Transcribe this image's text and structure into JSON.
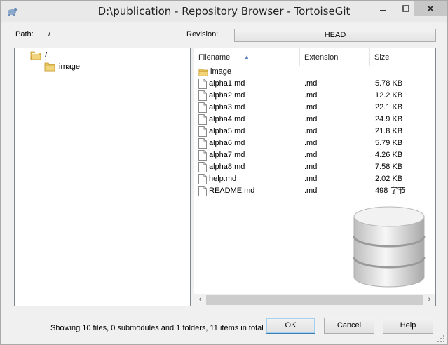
{
  "window": {
    "title": "D:\\publication - Repository Browser - TortoiseGit",
    "icon": "tortoise-icon",
    "controls": [
      "minimize",
      "maximize",
      "close"
    ]
  },
  "path": {
    "label": "Path:",
    "value": "/"
  },
  "revision": {
    "label": "Revision:",
    "button_label": "HEAD"
  },
  "tree": {
    "root": {
      "label": "/",
      "icon": "folder-open-icon"
    },
    "children": [
      {
        "label": "image",
        "icon": "folder-icon"
      }
    ]
  },
  "list": {
    "headers": {
      "filename": "Filename",
      "extension": "Extension",
      "size": "Size"
    },
    "sort": {
      "column": "filename",
      "direction": "ascending"
    },
    "rows": [
      {
        "name": "image",
        "extension": "",
        "size": "",
        "type": "folder"
      },
      {
        "name": "alpha1.md",
        "extension": ".md",
        "size": "5.78 KB",
        "type": "file"
      },
      {
        "name": "alpha2.md",
        "extension": ".md",
        "size": "12.2 KB",
        "type": "file"
      },
      {
        "name": "alpha3.md",
        "extension": ".md",
        "size": "22.1 KB",
        "type": "file"
      },
      {
        "name": "alpha4.md",
        "extension": ".md",
        "size": "24.9 KB",
        "type": "file"
      },
      {
        "name": "alpha5.md",
        "extension": ".md",
        "size": "21.8 KB",
        "type": "file"
      },
      {
        "name": "alpha6.md",
        "extension": ".md",
        "size": "5.79 KB",
        "type": "file"
      },
      {
        "name": "alpha7.md",
        "extension": ".md",
        "size": "4.26 KB",
        "type": "file"
      },
      {
        "name": "alpha8.md",
        "extension": ".md",
        "size": "7.58 KB",
        "type": "file"
      },
      {
        "name": "help.md",
        "extension": ".md",
        "size": "2.02 KB",
        "type": "file"
      },
      {
        "name": "README.md",
        "extension": ".md",
        "size": "498 字节",
        "type": "file"
      }
    ]
  },
  "status": {
    "text": "Showing 10 files, 0 submodules and 1 folders, 11 items in total"
  },
  "buttons": {
    "ok": "OK",
    "cancel": "Cancel",
    "help": "Help"
  },
  "colors": {
    "folder": "#e8c458",
    "accent": "#3c7fb1"
  }
}
